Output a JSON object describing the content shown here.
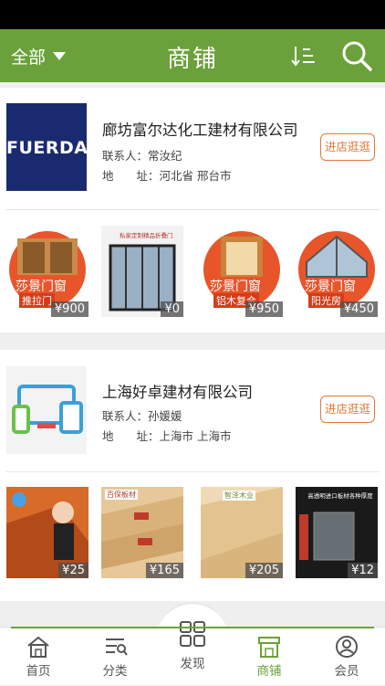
{
  "header": {
    "filter_label": "全部",
    "title": "商铺"
  },
  "shops": [
    {
      "name": "廊坊富尔达化工建材有限公司",
      "contact_label": "联系人：",
      "contact": "常汝纪",
      "address_label": "地　　址：",
      "address": "河北省 邢台市",
      "visit_label": "进店逛逛",
      "logo_text": "FUERDA",
      "products": [
        {
          "price": "¥900",
          "text_top": "莎景门窗",
          "text_bottom": "推拉门"
        },
        {
          "price": "¥0",
          "text_top": "私家定制精品折叠门",
          "text_bottom": ""
        },
        {
          "price": "¥950",
          "text_top": "莎景门窗",
          "text_bottom": "铝木复合"
        },
        {
          "price": "¥450",
          "text_top": "莎景门窗",
          "text_bottom": "阳光房"
        }
      ]
    },
    {
      "name": "上海好卓建材有限公司",
      "contact_label": "联系人：",
      "contact": "孙媛媛",
      "address_label": "地　　址：",
      "address": "上海市 上海市",
      "visit_label": "进店逛逛",
      "products": [
        {
          "price": "¥25",
          "text_top": "",
          "text_bottom": ""
        },
        {
          "price": "¥165",
          "text_top": "百保板材",
          "text_bottom": ""
        },
        {
          "price": "¥205",
          "text_top": "智泽木业",
          "text_bottom": ""
        },
        {
          "price": "¥12",
          "text_top": "高透明进口板材各种厚度",
          "text_bottom": ""
        }
      ]
    }
  ],
  "tabs": [
    {
      "label": "首页",
      "icon": "home-icon"
    },
    {
      "label": "分类",
      "icon": "category-list-icon"
    },
    {
      "label": "发现",
      "icon": "grid-discover-icon"
    },
    {
      "label": "商铺",
      "icon": "store-icon"
    },
    {
      "label": "会员",
      "icon": "user-icon"
    }
  ],
  "colors": {
    "brand_green": "#6aa13a",
    "accent_orange": "#e07a3a"
  }
}
